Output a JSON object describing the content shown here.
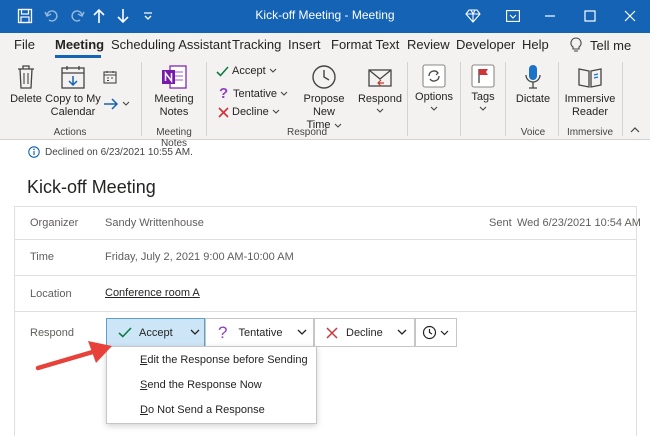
{
  "window": {
    "title": "Kick-off Meeting  -  Meeting",
    "icons": [
      "save-icon",
      "undo-icon",
      "redo-icon",
      "up-arrow-icon",
      "down-arrow-icon",
      "customize-icon",
      "diamond-icon",
      "ribbon-display-icon"
    ],
    "controls": [
      "minimize",
      "maximize",
      "close"
    ]
  },
  "menu": {
    "tabs": [
      "File",
      "Meeting",
      "Scheduling Assistant",
      "Tracking",
      "Insert",
      "Format Text",
      "Review",
      "Developer",
      "Help"
    ],
    "active": "Meeting",
    "tell_me": "Tell me"
  },
  "ribbon": {
    "actions": {
      "delete": "Delete",
      "copy_line1": "Copy to My",
      "copy_line2": "Calendar",
      "label": "Actions"
    },
    "notes": {
      "line1": "Meeting",
      "line2": "Notes",
      "label": "Meeting Notes"
    },
    "respond": {
      "accept": "Accept",
      "tentative": "Tentative",
      "decline": "Decline",
      "propose_line1": "Propose New",
      "propose_line2": "Time",
      "respond": "Respond",
      "label": "Respond"
    },
    "options": "Options",
    "tags": "Tags",
    "voice": {
      "dictate": "Dictate",
      "label": "Voice"
    },
    "immersive": {
      "line1": "Immersive",
      "line2": "Reader",
      "label": "Immersive"
    }
  },
  "message": {
    "info": "Declined on 6/23/2021 10:55 AM.",
    "subject": "Kick-off Meeting",
    "organizer_label": "Organizer",
    "organizer": "Sandy Writtenhouse",
    "sent_label": "Sent",
    "sent": "Wed 6/23/2021 10:54 AM",
    "time_label": "Time",
    "time": "Friday, July 2, 2021 9:00 AM-10:00 AM",
    "location_label": "Location",
    "location": "Conference room A",
    "respond_label": "Respond"
  },
  "respond_buttons": {
    "accept": "Accept",
    "tentative": "Tentative",
    "decline": "Decline"
  },
  "dropdown": {
    "edit_first": "E",
    "edit_rest": "dit the Response before Sending",
    "send_first": "S",
    "send_rest": "end the Response Now",
    "donot_first": "D",
    "donot_rest": "o Not Send a Response"
  },
  "colors": {
    "title_bar": "#1563b5",
    "ribbon": "#f3f2f1",
    "accept_check": "#107c41",
    "decline_x": "#d13438",
    "tentative": "#8f3fc9",
    "onenote": "#7719aa",
    "arrow": "#e8413a"
  }
}
